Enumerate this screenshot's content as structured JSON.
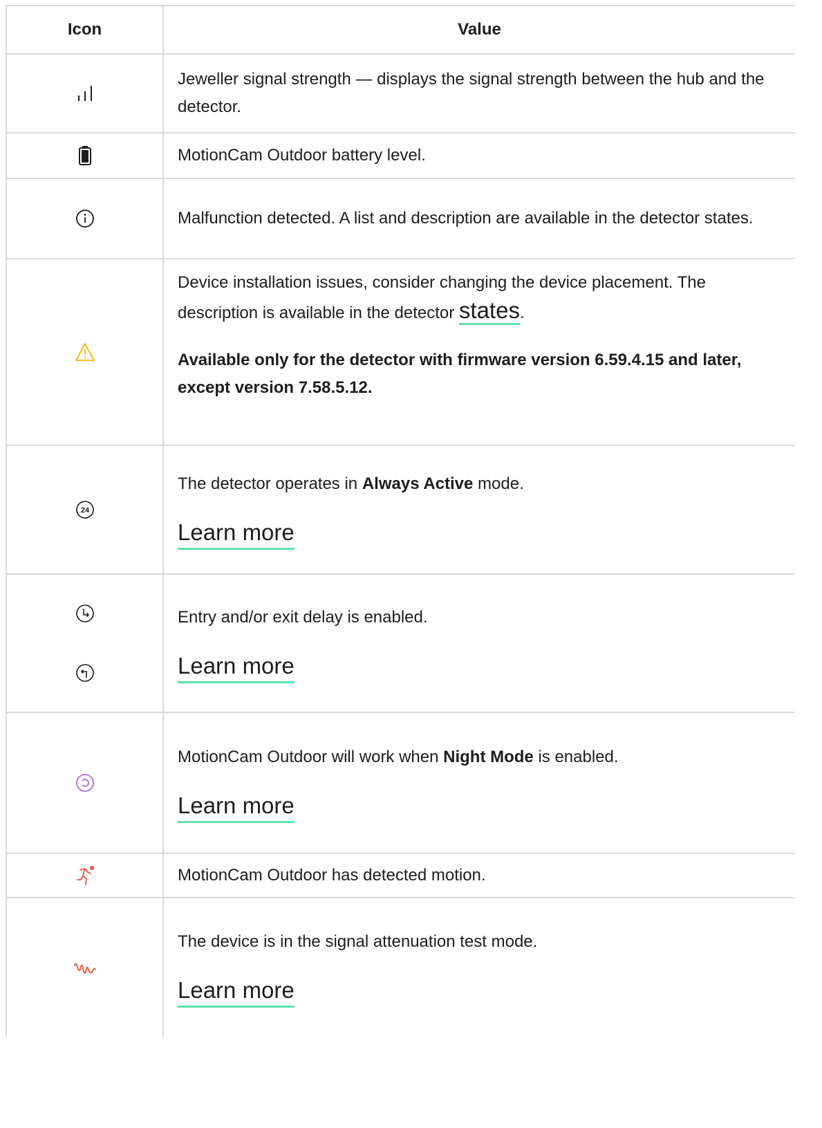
{
  "header": {
    "icon": "Icon",
    "value": "Value"
  },
  "rows": [
    {
      "icon": "signal-strength-icon",
      "text": "Jeweller signal strength — displays the signal strength between the hub and the detector."
    },
    {
      "icon": "battery-icon",
      "text": "MotionCam Outdoor battery level."
    },
    {
      "icon": "info-icon",
      "text": "Malfunction detected. A list and description are available in the detector states."
    },
    {
      "icon": "warning-icon",
      "text_before": "Device installation issues, consider changing the device placement. The description is available in the detector ",
      "link": "states",
      "text_after": ".",
      "note": "Available only for the detector with firmware version 6.59.4.15 and later, except version 7.58.5.12."
    },
    {
      "icon": "always-active-24-icon",
      "text_before": "The detector operates in ",
      "bold": "Always Active",
      "text_after": " mode.",
      "link": "Learn more"
    },
    {
      "icons": [
        "entry-delay-icon",
        "exit-delay-icon"
      ],
      "text": "Entry and/or exit delay is enabled.",
      "link": "Learn more"
    },
    {
      "icon": "night-mode-icon",
      "text_before": "MotionCam Outdoor will work when ",
      "bold": "Night Mode",
      "text_after": " is enabled.",
      "link": "Learn more"
    },
    {
      "icon": "motion-detected-icon",
      "text": "MotionCam Outdoor has detected motion."
    },
    {
      "icon": "signal-attenuation-icon",
      "text": "The device is in the signal attenuation test mode.",
      "link": "Learn more"
    }
  ],
  "colors": {
    "border": "#d9d9d9",
    "link_underline": "#5ee3ab",
    "warning": "#f6b400",
    "night_mode": "#a66cf0",
    "motion": "#e5533d"
  }
}
